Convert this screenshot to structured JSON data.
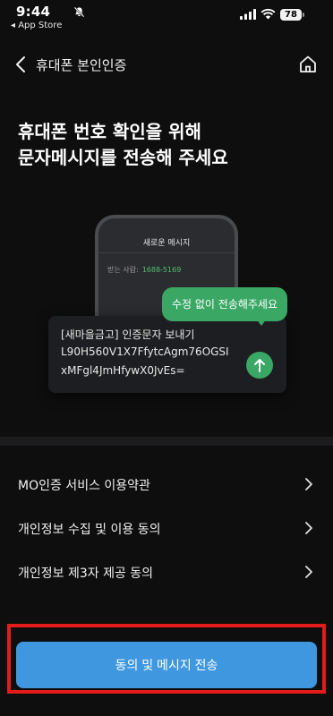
{
  "status_bar": {
    "time": "9:44",
    "back_app": "◂ App Store",
    "battery": "78"
  },
  "header": {
    "title": "휴대폰 본인인증"
  },
  "heading": {
    "line1": "휴대폰 번호 확인을 위해",
    "line2": "문자메시지를 전송해 주세요"
  },
  "illustration": {
    "phone_title": "새로운 메시지",
    "recipient_label": "받는 사람:",
    "recipient_number": "1688-5169",
    "bubble_text": "수정 없이 전송해주세요",
    "message_lines": [
      "[새마을금고] 인증문자 보내기",
      "L90H560V1X7FfytcAgm76OGSI",
      "xMFgl4JmHfywX0JvEs="
    ]
  },
  "menu": {
    "items": [
      {
        "label": "MO인증 서비스 이용약관"
      },
      {
        "label": "개인정보 수집 및 이용 동의"
      },
      {
        "label": "개인정보 제3자 제공 동의"
      }
    ]
  },
  "cta": {
    "label": "동의 및 메시지 전송"
  },
  "colors": {
    "background": "#0e0e0e",
    "accent_green": "#3aa864",
    "cta_blue": "#3f97e0",
    "highlight_red": "#e21b1b"
  }
}
